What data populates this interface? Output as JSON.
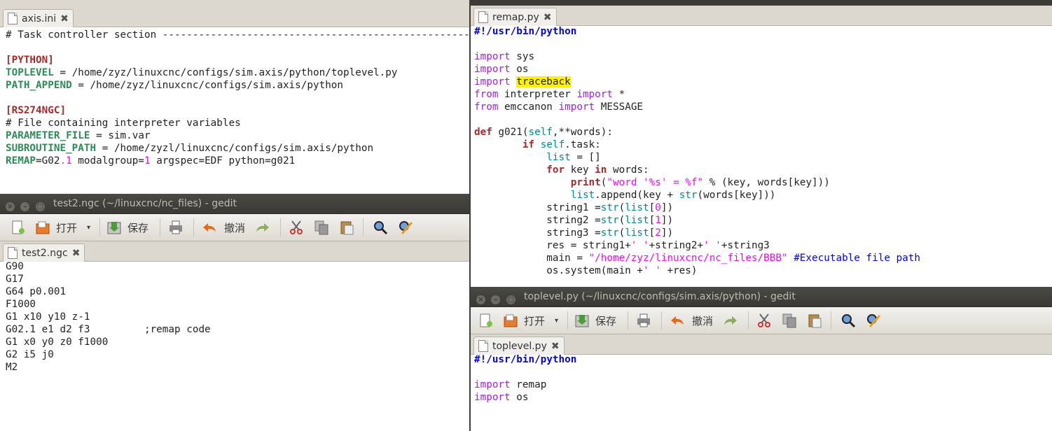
{
  "axis_ini": {
    "tab_label": "axis.ini",
    "lines": [
      [
        {
          "t": "# Task controller section -------------------------------------------------------------------",
          "c": "gray"
        }
      ],
      [],
      [
        {
          "t": "[PYTHON]",
          "c": "sec"
        }
      ],
      [
        {
          "t": "TOPLEVEL",
          "c": "key"
        },
        {
          "t": " = /home/zyz/linuxcnc/configs/sim.axis/python/toplevel.py"
        }
      ],
      [
        {
          "t": "PATH_APPEND",
          "c": "key"
        },
        {
          "t": " = /home/zyz/linuxcnc/configs/sim.axis/python"
        }
      ],
      [],
      [
        {
          "t": "[RS274NGC]",
          "c": "sec"
        }
      ],
      [
        {
          "t": "# File containing interpreter variables"
        }
      ],
      [
        {
          "t": "PARAMETER_FILE",
          "c": "key"
        },
        {
          "t": " = sim.var"
        }
      ],
      [
        {
          "t": "SUBROUTINE_PATH",
          "c": "key"
        },
        {
          "t": " = /home/zyzl/linuxcnc/configs/sim.axis/python"
        }
      ],
      [
        {
          "t": "REMAP",
          "c": "key"
        },
        {
          "t": "=G02"
        },
        {
          "t": ".1",
          "c": "num"
        },
        {
          "t": " modalgroup="
        },
        {
          "t": "1",
          "c": "num"
        },
        {
          "t": " argspec=EDF python=g021"
        }
      ]
    ]
  },
  "test2_window": {
    "title": "test2.ngc (~/linuxcnc/nc_files) - gedit",
    "tab_label": "test2.ngc",
    "toolbar": {
      "open_label": "打开",
      "save_label": "保存",
      "undo_label": "撤消"
    },
    "lines": [
      [
        {
          "t": "G90"
        }
      ],
      [
        {
          "t": "G17"
        }
      ],
      [
        {
          "t": "G64 p0.001"
        }
      ],
      [
        {
          "t": "F1000"
        }
      ],
      [
        {
          "t": "G1 x10 y10 z-1"
        }
      ],
      [
        {
          "t": "G02.1 e1 d2 f3         ;remap code"
        }
      ],
      [
        {
          "t": "G1 x0 y0 z0 f1000"
        }
      ],
      [
        {
          "t": "G2 i5 j0"
        }
      ],
      [
        {
          "t": "M2"
        }
      ]
    ]
  },
  "remap_py": {
    "tab_label": "remap.py",
    "lines": [
      [
        {
          "t": "#!/usr/bin/python",
          "c": "shb"
        }
      ],
      [],
      [
        {
          "t": "import",
          "c": "kw"
        },
        {
          "t": " sys"
        }
      ],
      [
        {
          "t": "import",
          "c": "kw"
        },
        {
          "t": " os"
        }
      ],
      [
        {
          "t": "import",
          "c": "kw"
        },
        {
          "t": " "
        },
        {
          "t": "traceback",
          "c": "hl"
        }
      ],
      [
        {
          "t": "from",
          "c": "kw"
        },
        {
          "t": " interpreter "
        },
        {
          "t": "import",
          "c": "kw"
        },
        {
          "t": " *"
        }
      ],
      [
        {
          "t": "from",
          "c": "kw"
        },
        {
          "t": " emccanon "
        },
        {
          "t": "import",
          "c": "kw"
        },
        {
          "t": " MESSAGE"
        }
      ],
      [],
      [
        {
          "t": "def",
          "c": "kwb"
        },
        {
          "t": " g021("
        },
        {
          "t": "self",
          "c": "self"
        },
        {
          "t": ",**words):"
        }
      ],
      [
        {
          "t": "        "
        },
        {
          "t": "if",
          "c": "kwb"
        },
        {
          "t": " "
        },
        {
          "t": "self",
          "c": "self"
        },
        {
          "t": ".task:"
        }
      ],
      [
        {
          "t": "            "
        },
        {
          "t": "list",
          "c": "fn"
        },
        {
          "t": " = []"
        }
      ],
      [
        {
          "t": "            "
        },
        {
          "t": "for",
          "c": "kwb"
        },
        {
          "t": " key "
        },
        {
          "t": "in",
          "c": "kwb"
        },
        {
          "t": " words:"
        }
      ],
      [
        {
          "t": "                "
        },
        {
          "t": "print",
          "c": "kwb"
        },
        {
          "t": "("
        },
        {
          "t": "\"word '%s' = %f\"",
          "c": "str"
        },
        {
          "t": " % (key, words[key]))"
        }
      ],
      [
        {
          "t": "                "
        },
        {
          "t": "list",
          "c": "fn"
        },
        {
          "t": ".append(key + "
        },
        {
          "t": "str",
          "c": "fn"
        },
        {
          "t": "(words[key]))"
        }
      ],
      [
        {
          "t": "            string1 ="
        },
        {
          "t": "str",
          "c": "fn"
        },
        {
          "t": "("
        },
        {
          "t": "list",
          "c": "fn"
        },
        {
          "t": "["
        },
        {
          "t": "0",
          "c": "num"
        },
        {
          "t": "])"
        }
      ],
      [
        {
          "t": "            string2 ="
        },
        {
          "t": "str",
          "c": "fn"
        },
        {
          "t": "("
        },
        {
          "t": "list",
          "c": "fn"
        },
        {
          "t": "["
        },
        {
          "t": "1",
          "c": "num"
        },
        {
          "t": "])"
        }
      ],
      [
        {
          "t": "            string3 ="
        },
        {
          "t": "str",
          "c": "fn"
        },
        {
          "t": "("
        },
        {
          "t": "list",
          "c": "fn"
        },
        {
          "t": "["
        },
        {
          "t": "2",
          "c": "num"
        },
        {
          "t": "])"
        }
      ],
      [
        {
          "t": "            res = string1+"
        },
        {
          "t": "' '",
          "c": "str"
        },
        {
          "t": "+string2+"
        },
        {
          "t": "' '",
          "c": "str"
        },
        {
          "t": "+string3"
        }
      ],
      [
        {
          "t": "            main = "
        },
        {
          "t": "\"/home/zyz/linuxcnc/nc_files/BBB\"",
          "c": "str"
        },
        {
          "t": " "
        },
        {
          "t": "#Executable file path",
          "c": "cmt"
        }
      ],
      [
        {
          "t": "            os.system(main +"
        },
        {
          "t": "' '",
          "c": "str"
        },
        {
          "t": " +res)"
        }
      ]
    ]
  },
  "toplevel_window": {
    "title": "toplevel.py (~/linuxcnc/configs/sim.axis/python) - gedit",
    "tab_label": "toplevel.py",
    "toolbar": {
      "open_label": "打开",
      "save_label": "保存",
      "undo_label": "撤消"
    },
    "lines": [
      [
        {
          "t": "#!/usr/bin/python",
          "c": "shb"
        }
      ],
      [],
      [
        {
          "t": "import",
          "c": "kw"
        },
        {
          "t": " remap"
        }
      ],
      [
        {
          "t": "import",
          "c": "kw"
        },
        {
          "t": " os"
        }
      ]
    ]
  }
}
